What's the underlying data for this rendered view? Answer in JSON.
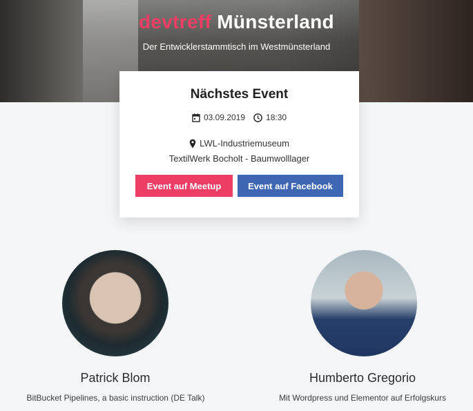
{
  "header": {
    "brand": "devtreff",
    "city": "Münsterland",
    "subtitle": "Der Entwicklerstammtisch im Westmünsterland"
  },
  "event": {
    "heading": "Nächstes Event",
    "date": "03.09.2019",
    "time": "18:30",
    "location_line1": "LWL-Industriemuseum",
    "location_line2": "TextilWerk Bocholt - Baumwolllager",
    "meetup_label": "Event auf Meetup",
    "facebook_label": "Event auf Facebook"
  },
  "speakers": [
    {
      "name": "Patrick Blom",
      "talk": "BitBucket Pipelines, a basic instruction (DE Talk)"
    },
    {
      "name": "Humberto Gregorio",
      "talk": "Mit Wordpress und Elementor auf Erfolgskurs"
    }
  ],
  "colors": {
    "accent": "#ee3e65",
    "facebook": "#3f66b3",
    "background": "#f4f5f7"
  },
  "icons": [
    "calendar-icon",
    "clock-icon",
    "location-pin-icon"
  ]
}
